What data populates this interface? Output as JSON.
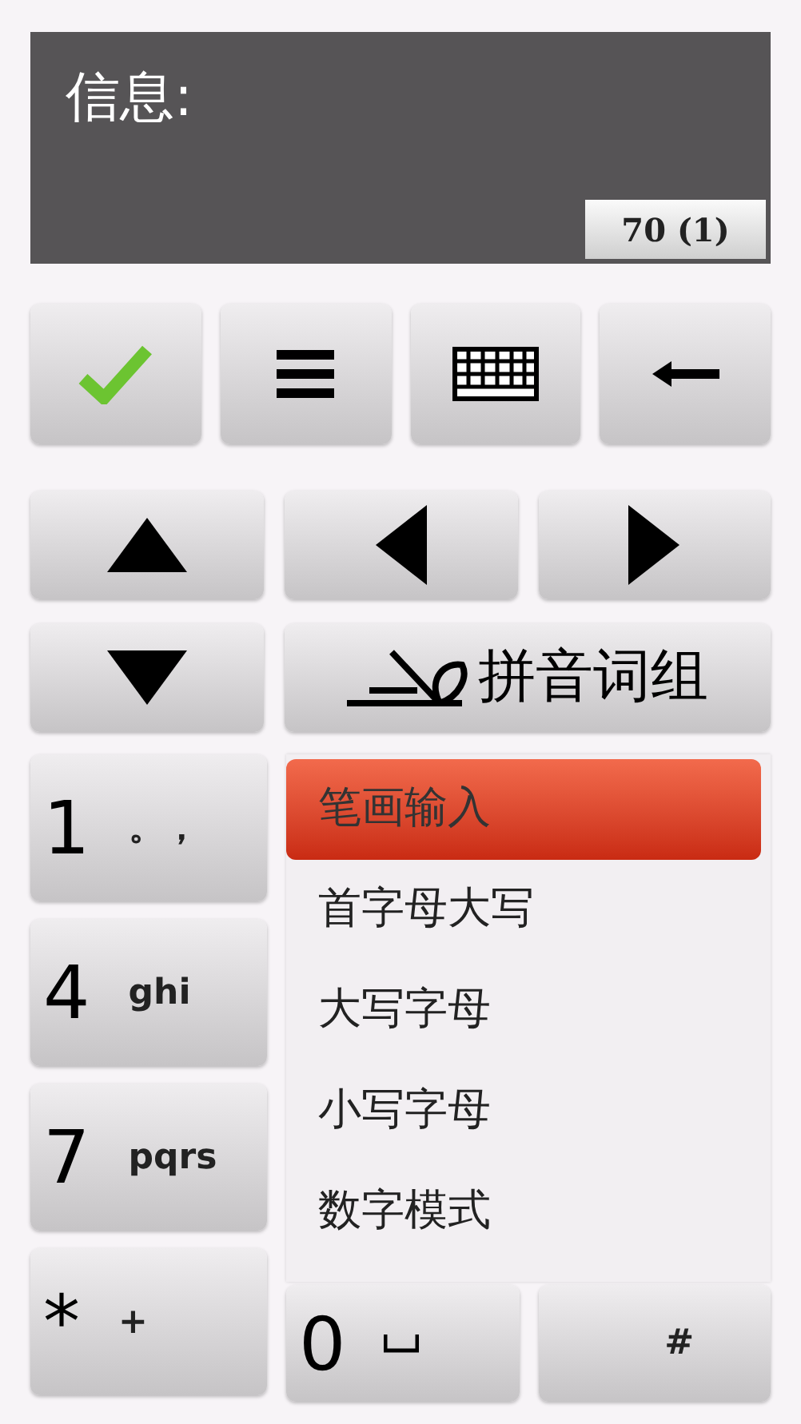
{
  "message": {
    "label": "信息:",
    "counter": "70 (1)"
  },
  "toolbar": [
    {
      "kind": "check"
    },
    {
      "kind": "menu"
    },
    {
      "kind": "keyboard"
    },
    {
      "kind": "backspace"
    }
  ],
  "navigation": [
    {
      "kind": "up"
    },
    {
      "kind": "left"
    },
    {
      "kind": "right"
    },
    {
      "kind": "down"
    }
  ],
  "mode_button": {
    "label": "拼音词组"
  },
  "keys": [
    {
      "kind": "text",
      "digit": "1",
      "letters": "。，"
    },
    {
      "kind": "text",
      "digit": "4",
      "letters": "ghi"
    },
    {
      "kind": "text",
      "digit": "7",
      "letters": "pqrs"
    },
    {
      "kind": "text",
      "digit": "*",
      "letters": "+"
    }
  ],
  "input_menu": [
    {
      "label": "笔画输入",
      "selected": true
    },
    {
      "label": "首字母大写",
      "selected": false
    },
    {
      "label": "大写字母",
      "selected": false
    },
    {
      "label": "小写字母",
      "selected": false
    },
    {
      "label": "数字模式",
      "selected": false
    }
  ],
  "bottom_keys": [
    {
      "kind": "space",
      "digit": "0"
    },
    {
      "kind": "text",
      "letters": "#"
    }
  ]
}
